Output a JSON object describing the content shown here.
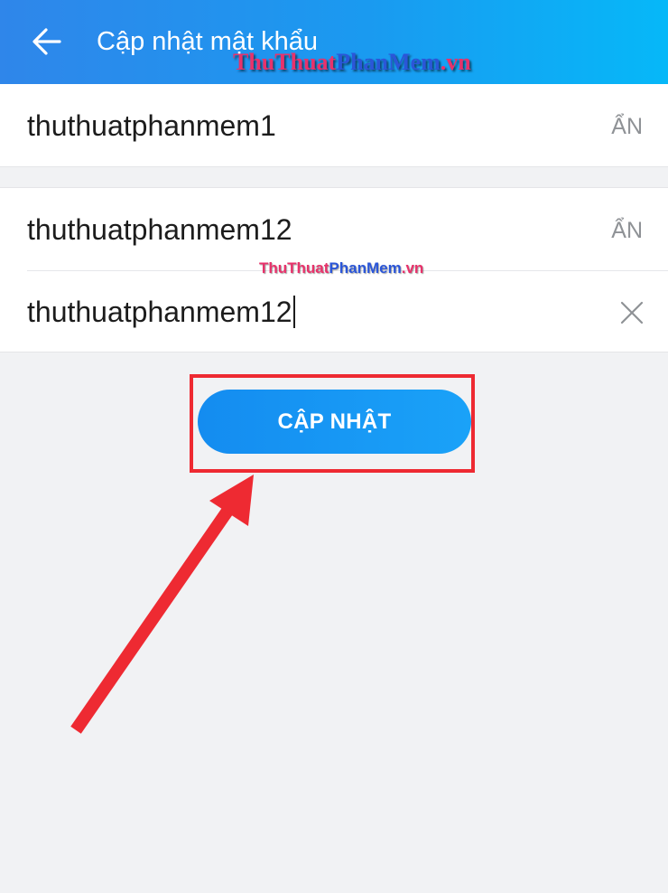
{
  "header": {
    "title": "Cập nhật mật khẩu",
    "back_icon": "arrow-left-icon"
  },
  "watermark": {
    "part1": "ThuThuat",
    "part2": "PhanMem",
    "part3": ".vn"
  },
  "fields": [
    {
      "value": "thuthuatphanmem1",
      "action_label": "ẨN"
    },
    {
      "value": "thuthuatphanmem12",
      "action_label": "ẨN"
    },
    {
      "value": "thuthuatphanmem12",
      "action_icon": "close-icon"
    }
  ],
  "update_button": {
    "label": "CẬP NHẬT"
  },
  "colors": {
    "header_start": "#2f86ea",
    "header_end": "#06b8f8",
    "button": "#1a97f4",
    "annotation": "#ee2a32",
    "background": "#f1f2f4"
  }
}
